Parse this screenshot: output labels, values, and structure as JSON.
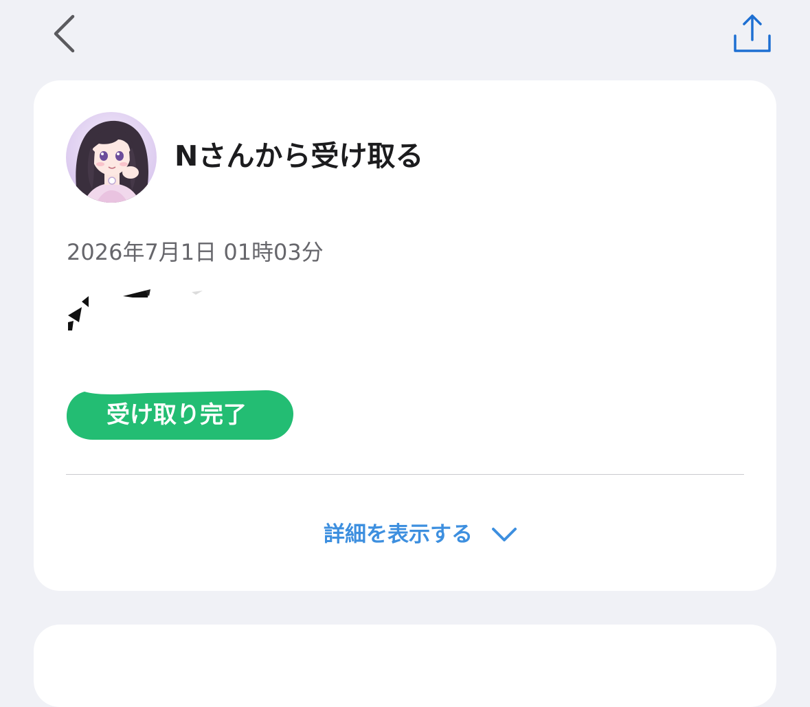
{
  "header": {
    "back_icon": "chevron-left-icon",
    "share_icon": "share-icon",
    "accent_color": "#1d6fd2"
  },
  "card": {
    "title": "Nさんから受け取る",
    "datetime": "2026年7月1日 01時03分",
    "status": {
      "label": "受け取り完了",
      "color": "#23bd73"
    },
    "details_toggle": {
      "label": "詳細を表示する",
      "icon": "chevron-down-icon",
      "color": "#3d8fdf"
    }
  }
}
